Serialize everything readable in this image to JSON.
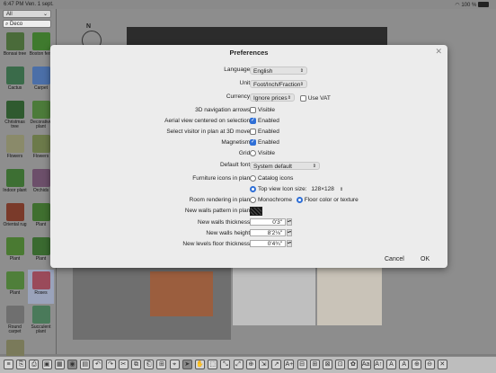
{
  "status": {
    "time": "6:47 PM",
    "date": "Ven. 1 sept.",
    "battery": "100 %",
    "battery_level": 1.0
  },
  "sidebar": {
    "category": "All",
    "search": "Deco",
    "items": [
      {
        "label": "Bonsai tree",
        "color": "#4a6b3a"
      },
      {
        "label": "Boston fern",
        "color": "#3f7a2e"
      },
      {
        "label": "Cactus",
        "color": "#3a6b4a"
      },
      {
        "label": "Carpet",
        "color": "#4b6fa8"
      },
      {
        "label": "Christmas tree",
        "color": "#2f5a2f"
      },
      {
        "label": "Decorative plant",
        "color": "#4c7b3a"
      },
      {
        "label": "Flowers",
        "color": "#8a8a6a"
      },
      {
        "label": "Flowers",
        "color": "#6c7a4a"
      },
      {
        "label": "Indoor plant",
        "color": "#3d6f33"
      },
      {
        "label": "Orchids",
        "color": "#6c4f6a"
      },
      {
        "label": "Oriental rug",
        "color": "#7a3a2a"
      },
      {
        "label": "Plant",
        "color": "#3f6f2f"
      },
      {
        "label": "Plant",
        "color": "#4a7a32"
      },
      {
        "label": "Plant",
        "color": "#3a6a30"
      },
      {
        "label": "Plant",
        "color": "#4f7f3a"
      },
      {
        "label": "Roses",
        "color": "#9a4a5a",
        "selected": true
      },
      {
        "label": "Round carpet",
        "color": "#6f6f6f"
      },
      {
        "label": "Succulent plant",
        "color": "#4a7a5a"
      },
      {
        "label": "",
        "color": "#7a7a5a"
      }
    ]
  },
  "dialog": {
    "title": "Preferences",
    "close": "✕",
    "language": {
      "label": "Language:",
      "value": "English"
    },
    "unit": {
      "label": "Unit:",
      "value": "Foot/Inch/Fraction"
    },
    "currency": {
      "label": "Currency:",
      "value": "Ignore prices",
      "vat": "Use VAT"
    },
    "nav_arrows": {
      "label": "3D navigation arrows:",
      "option": "Visible"
    },
    "aerial": {
      "label": "Aerial view centered on selection:",
      "option": "Enabled"
    },
    "visitor": {
      "label": "Select visitor in plan at 3D move:",
      "option": "Enabled"
    },
    "magnetism": {
      "label": "Magnetism:",
      "option": "Enabled"
    },
    "grid": {
      "label": "Grid:",
      "option": "Visible"
    },
    "font": {
      "label": "Default font:",
      "value": "System default"
    },
    "furniture_icons": {
      "label": "Furniture icons in plan:",
      "option1": "Catalog icons",
      "option2": "Top view Icon size:",
      "size": "128×128"
    },
    "room_render": {
      "label": "Room rendering in plan:",
      "option1": "Monochrome",
      "option2": "Floor color or texture"
    },
    "walls_pattern": {
      "label": "New walls pattern in plan:"
    },
    "walls_thickness": {
      "label": "New walls thickness:",
      "value": "0'3\""
    },
    "walls_height": {
      "label": "New walls height:",
      "value": "8'2⅛\""
    },
    "floor_thickness": {
      "label": "New levels floor thickness:",
      "value": "0'4¾\""
    },
    "cancel": "Cancel",
    "ok": "OK"
  },
  "toolbar": {
    "buttons": [
      "≡",
      "⎘",
      "⎙",
      "▣",
      "▦",
      "◉",
      "▤",
      "↶",
      "↷",
      "✂",
      "⧉",
      "⎗",
      "⊞",
      "⌖",
      "➤",
      "✋",
      "⬚",
      "⤡",
      "⤢",
      "⊕",
      "⇲",
      "↗",
      "A+",
      "⊟",
      "⊞",
      "⊠",
      "⊡",
      "✿",
      "Aa",
      "A↑",
      "A",
      "A",
      "⊕",
      "⊖",
      "✕"
    ]
  }
}
